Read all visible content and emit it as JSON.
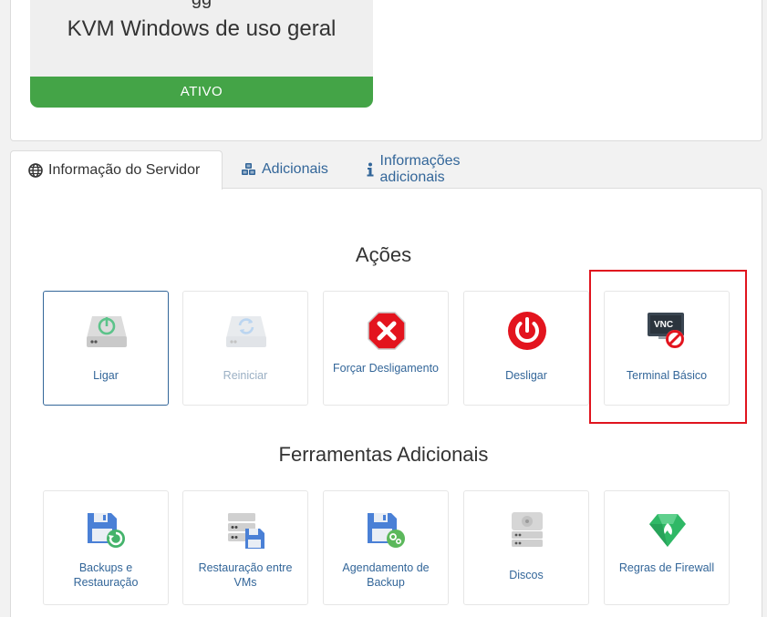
{
  "product": {
    "top_glyph": "gg",
    "name": "KVM Windows de uso geral",
    "status": "ATIVO",
    "status_color": "#44a447"
  },
  "tabs": [
    {
      "label": "Informação do Servidor",
      "icon": "globe-icon",
      "active": true
    },
    {
      "label": "Adicionais",
      "icon": "cubes-icon",
      "active": false
    },
    {
      "label": "Informações adicionais",
      "icon": "info-icon",
      "active": false
    }
  ],
  "actions": {
    "title": "Ações",
    "items": [
      {
        "label": "Ligar",
        "icon": "power-on-drive-icon",
        "state": "selected"
      },
      {
        "label": "Reiniciar",
        "icon": "restart-drive-icon",
        "state": "disabled"
      },
      {
        "label": "Forçar Desligamento",
        "icon": "force-stop-icon",
        "state": "normal"
      },
      {
        "label": "Desligar",
        "icon": "power-off-icon",
        "state": "normal"
      },
      {
        "label": "Terminal Básico",
        "icon": "vnc-terminal-icon",
        "badge": "VNC",
        "state": "highlighted"
      }
    ]
  },
  "tools": {
    "title": "Ferramentas Adicionais",
    "items": [
      {
        "label": "Backups e Restauração",
        "icon": "backup-restore-icon"
      },
      {
        "label": "Restauração entre VMs",
        "icon": "vm-restore-icon"
      },
      {
        "label": "Agendamento de Backup",
        "icon": "backup-schedule-icon"
      },
      {
        "label": "Discos",
        "icon": "disks-icon"
      },
      {
        "label": "Regras de Firewall",
        "icon": "firewall-icon"
      }
    ]
  },
  "colors": {
    "link": "#336699",
    "highlight": "#e0141e",
    "danger": "#e3141e",
    "success": "#44a447"
  }
}
